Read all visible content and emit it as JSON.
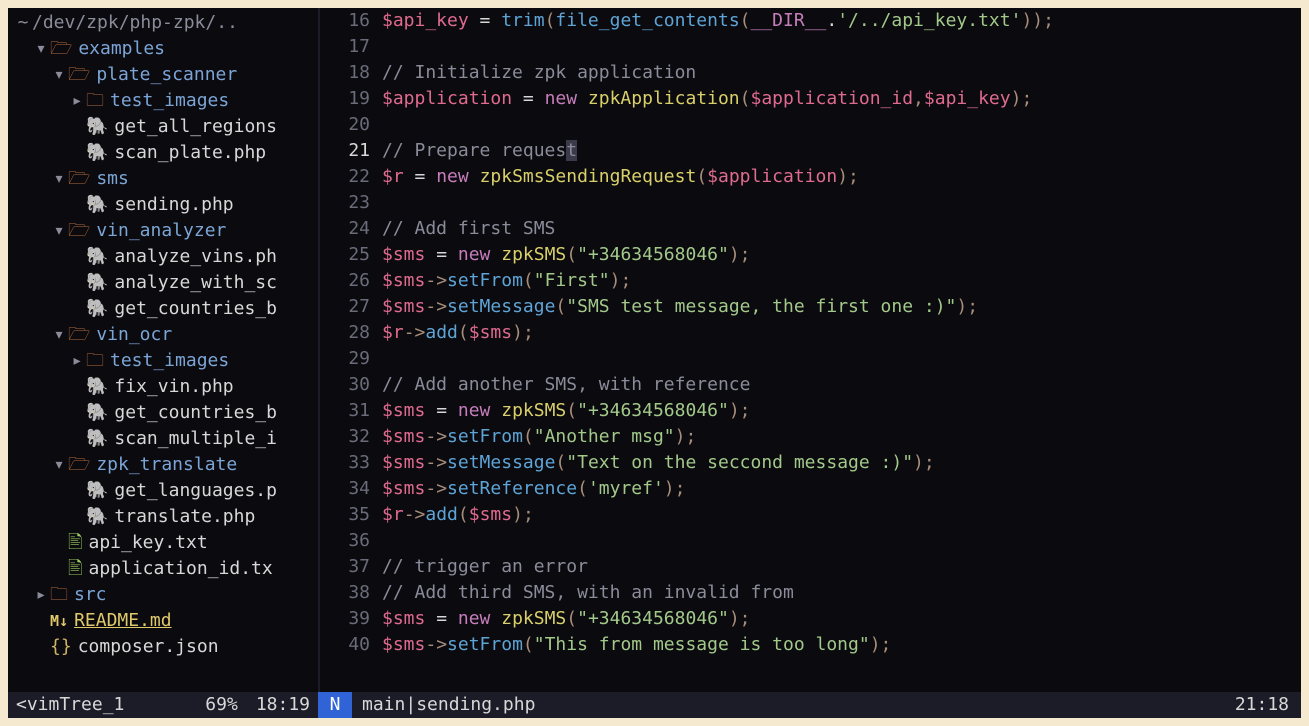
{
  "tree": {
    "root_row": {
      "arrow": "~",
      "path": "/dev/zpk/php-zpk/.."
    },
    "rows": [
      {
        "depth": 0,
        "arrow": "▾",
        "icon": "folder",
        "name": "examples",
        "type": "dir"
      },
      {
        "depth": 1,
        "arrow": "▾",
        "icon": "folder",
        "name": "plate_scanner",
        "type": "dir"
      },
      {
        "depth": 2,
        "arrow": "▸",
        "icon": "closedfolder",
        "name": "test_images",
        "type": "dir-closed"
      },
      {
        "depth": 2,
        "arrow": "",
        "icon": "php",
        "name": "get_all_regions",
        "type": "file"
      },
      {
        "depth": 2,
        "arrow": "",
        "icon": "php",
        "name": "scan_plate.php",
        "type": "file"
      },
      {
        "depth": 1,
        "arrow": "▾",
        "icon": "folder",
        "name": "sms",
        "type": "dir"
      },
      {
        "depth": 2,
        "arrow": "",
        "icon": "php",
        "name": "sending.php",
        "type": "file"
      },
      {
        "depth": 1,
        "arrow": "▾",
        "icon": "folder",
        "name": "vin_analyzer",
        "type": "dir"
      },
      {
        "depth": 2,
        "arrow": "",
        "icon": "php",
        "name": "analyze_vins.ph",
        "type": "file"
      },
      {
        "depth": 2,
        "arrow": "",
        "icon": "php",
        "name": "analyze_with_sc",
        "type": "file"
      },
      {
        "depth": 2,
        "arrow": "",
        "icon": "php",
        "name": "get_countries_b",
        "type": "file"
      },
      {
        "depth": 1,
        "arrow": "▾",
        "icon": "folder",
        "name": "vin_ocr",
        "type": "dir"
      },
      {
        "depth": 2,
        "arrow": "▸",
        "icon": "closedfolder",
        "name": "test_images",
        "type": "dir-closed"
      },
      {
        "depth": 2,
        "arrow": "",
        "icon": "php",
        "name": "fix_vin.php",
        "type": "file"
      },
      {
        "depth": 2,
        "arrow": "",
        "icon": "php",
        "name": "get_countries_b",
        "type": "file"
      },
      {
        "depth": 2,
        "arrow": "",
        "icon": "php",
        "name": "scan_multiple_i",
        "type": "file"
      },
      {
        "depth": 1,
        "arrow": "▾",
        "icon": "folder",
        "name": "zpk_translate",
        "type": "dir"
      },
      {
        "depth": 2,
        "arrow": "",
        "icon": "php",
        "name": "get_languages.p",
        "type": "file"
      },
      {
        "depth": 2,
        "arrow": "",
        "icon": "php",
        "name": "translate.php",
        "type": "file"
      },
      {
        "depth": 1,
        "arrow": "",
        "icon": "txt",
        "name": "api_key.txt",
        "type": "file"
      },
      {
        "depth": 1,
        "arrow": "",
        "icon": "txt",
        "name": "application_id.tx",
        "type": "file"
      },
      {
        "depth": 0,
        "arrow": "▸",
        "icon": "closedfolder",
        "name": "src",
        "type": "dir-closed"
      },
      {
        "depth": 0,
        "arrow": "",
        "icon": "md",
        "name": "README.md",
        "type": "readme"
      },
      {
        "depth": 0,
        "arrow": "",
        "icon": "json",
        "name": "composer.json",
        "type": "file"
      }
    ]
  },
  "code": {
    "lines": [
      {
        "n": 16,
        "tokens": [
          [
            "var",
            "$api_key"
          ],
          [
            "op",
            " = "
          ],
          [
            "func",
            "trim"
          ],
          [
            "punc",
            "("
          ],
          [
            "func",
            "file_get_contents"
          ],
          [
            "punc",
            "("
          ],
          [
            "const",
            "__DIR__"
          ],
          [
            "op",
            "."
          ],
          [
            "str",
            "'/../api_key.txt'"
          ],
          [
            "punc",
            "))"
          ],
          [
            "punc",
            ";"
          ]
        ]
      },
      {
        "n": 17,
        "tokens": []
      },
      {
        "n": 18,
        "tokens": [
          [
            "cmt",
            "// Initialize zpk application"
          ]
        ]
      },
      {
        "n": 19,
        "tokens": [
          [
            "var",
            "$application"
          ],
          [
            "op",
            " = "
          ],
          [
            "kw",
            "new"
          ],
          [
            "op",
            " "
          ],
          [
            "class",
            "zpkApplication"
          ],
          [
            "punc",
            "("
          ],
          [
            "var",
            "$application_id"
          ],
          [
            "punc",
            ","
          ],
          [
            "var",
            "$api_key"
          ],
          [
            "punc",
            ")"
          ],
          [
            "punc",
            ";"
          ]
        ]
      },
      {
        "n": 20,
        "tokens": []
      },
      {
        "n": 21,
        "current": true,
        "tokens": [
          [
            "cmt",
            "// Prepare reques"
          ],
          [
            "cursor",
            "t"
          ]
        ]
      },
      {
        "n": 22,
        "tokens": [
          [
            "var",
            "$r"
          ],
          [
            "op",
            " = "
          ],
          [
            "kw",
            "new"
          ],
          [
            "op",
            " "
          ],
          [
            "class",
            "zpkSmsSendingRequest"
          ],
          [
            "punc",
            "("
          ],
          [
            "var",
            "$application"
          ],
          [
            "punc",
            ")"
          ],
          [
            "punc",
            ";"
          ]
        ]
      },
      {
        "n": 23,
        "tokens": []
      },
      {
        "n": 24,
        "tokens": [
          [
            "cmt",
            "// Add first SMS"
          ]
        ]
      },
      {
        "n": 25,
        "tokens": [
          [
            "var",
            "$sms"
          ],
          [
            "op",
            " = "
          ],
          [
            "kw",
            "new"
          ],
          [
            "op",
            " "
          ],
          [
            "class",
            "zpkSMS"
          ],
          [
            "punc",
            "("
          ],
          [
            "str",
            "\"+34634568046\""
          ],
          [
            "punc",
            ")"
          ],
          [
            "punc",
            ";"
          ]
        ]
      },
      {
        "n": 26,
        "tokens": [
          [
            "var",
            "$sms"
          ],
          [
            "punc",
            "->"
          ],
          [
            "func",
            "setFrom"
          ],
          [
            "punc",
            "("
          ],
          [
            "str",
            "\"First\""
          ],
          [
            "punc",
            ")"
          ],
          [
            "punc",
            ";"
          ]
        ]
      },
      {
        "n": 27,
        "tokens": [
          [
            "var",
            "$sms"
          ],
          [
            "punc",
            "->"
          ],
          [
            "func",
            "setMessage"
          ],
          [
            "punc",
            "("
          ],
          [
            "str",
            "\"SMS test message, the first one :)\""
          ],
          [
            "punc",
            ")"
          ],
          [
            "punc",
            ";"
          ]
        ]
      },
      {
        "n": 28,
        "tokens": [
          [
            "var",
            "$r"
          ],
          [
            "punc",
            "->"
          ],
          [
            "func",
            "add"
          ],
          [
            "punc",
            "("
          ],
          [
            "var",
            "$sms"
          ],
          [
            "punc",
            ")"
          ],
          [
            "punc",
            ";"
          ]
        ]
      },
      {
        "n": 29,
        "tokens": []
      },
      {
        "n": 30,
        "tokens": [
          [
            "cmt",
            "// Add another SMS, with reference"
          ]
        ]
      },
      {
        "n": 31,
        "tokens": [
          [
            "var",
            "$sms"
          ],
          [
            "op",
            " = "
          ],
          [
            "kw",
            "new"
          ],
          [
            "op",
            " "
          ],
          [
            "class",
            "zpkSMS"
          ],
          [
            "punc",
            "("
          ],
          [
            "str",
            "\"+34634568046\""
          ],
          [
            "punc",
            ")"
          ],
          [
            "punc",
            ";"
          ]
        ]
      },
      {
        "n": 32,
        "tokens": [
          [
            "var",
            "$sms"
          ],
          [
            "punc",
            "->"
          ],
          [
            "func",
            "setFrom"
          ],
          [
            "punc",
            "("
          ],
          [
            "str",
            "\"Another msg\""
          ],
          [
            "punc",
            ")"
          ],
          [
            "punc",
            ";"
          ]
        ]
      },
      {
        "n": 33,
        "tokens": [
          [
            "var",
            "$sms"
          ],
          [
            "punc",
            "->"
          ],
          [
            "func",
            "setMessage"
          ],
          [
            "punc",
            "("
          ],
          [
            "str",
            "\"Text on the seccond message :)\""
          ],
          [
            "punc",
            ")"
          ],
          [
            "punc",
            ";"
          ]
        ]
      },
      {
        "n": 34,
        "tokens": [
          [
            "var",
            "$sms"
          ],
          [
            "punc",
            "->"
          ],
          [
            "func",
            "setReference"
          ],
          [
            "punc",
            "("
          ],
          [
            "str",
            "'myref'"
          ],
          [
            "punc",
            ")"
          ],
          [
            "punc",
            ";"
          ]
        ]
      },
      {
        "n": 35,
        "tokens": [
          [
            "var",
            "$r"
          ],
          [
            "punc",
            "->"
          ],
          [
            "func",
            "add"
          ],
          [
            "punc",
            "("
          ],
          [
            "var",
            "$sms"
          ],
          [
            "punc",
            ")"
          ],
          [
            "punc",
            ";"
          ]
        ]
      },
      {
        "n": 36,
        "tokens": []
      },
      {
        "n": 37,
        "tokens": [
          [
            "cmt",
            "// trigger an error"
          ]
        ]
      },
      {
        "n": 38,
        "tokens": [
          [
            "cmt",
            "// Add third SMS, with an invalid from"
          ]
        ]
      },
      {
        "n": 39,
        "tokens": [
          [
            "var",
            "$sms"
          ],
          [
            "op",
            " = "
          ],
          [
            "kw",
            "new"
          ],
          [
            "op",
            " "
          ],
          [
            "class",
            "zpkSMS"
          ],
          [
            "punc",
            "("
          ],
          [
            "str",
            "\"+34634568046\""
          ],
          [
            "punc",
            ")"
          ],
          [
            "punc",
            ";"
          ]
        ]
      },
      {
        "n": 40,
        "tokens": [
          [
            "var",
            "$sms"
          ],
          [
            "punc",
            "->"
          ],
          [
            "func",
            "setFrom"
          ],
          [
            "punc",
            "("
          ],
          [
            "str",
            "\"This from message is too long\""
          ],
          [
            "punc",
            ")"
          ],
          [
            "punc",
            ";"
          ]
        ]
      }
    ]
  },
  "status": {
    "left_name": "<vimTree_1",
    "left_pct": "69%",
    "left_pos": "18:19",
    "mode": "N",
    "branch": "main",
    "sep": " | ",
    "filename": "sending.php",
    "right_pos": "21:18"
  }
}
